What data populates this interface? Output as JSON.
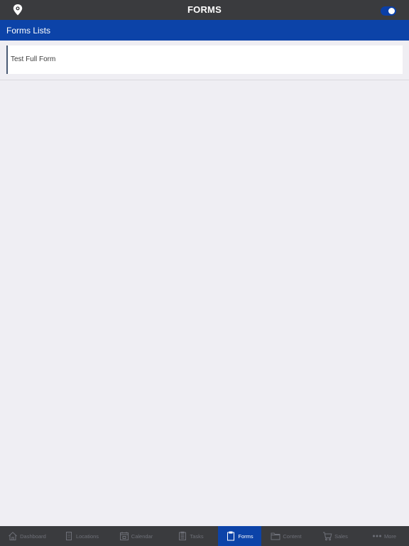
{
  "header": {
    "title": "FORMS",
    "location_icon": "map-pin-icon",
    "toggle_state": "on"
  },
  "section": {
    "title": "Forms Lists"
  },
  "forms": [
    {
      "name": "Test Full Form"
    }
  ],
  "tabbar": {
    "active": "Forms",
    "tabs": [
      {
        "label": "Dashboard",
        "icon": "home-icon"
      },
      {
        "label": "Locations",
        "icon": "building-icon"
      },
      {
        "label": "Calendar",
        "icon": "calendar-icon"
      },
      {
        "label": "Tasks",
        "icon": "tasks-icon"
      },
      {
        "label": "Forms",
        "icon": "clipboard-icon"
      },
      {
        "label": "Content",
        "icon": "folder-icon"
      },
      {
        "label": "Sales",
        "icon": "cart-icon"
      },
      {
        "label": "More",
        "icon": "more-dots-icon"
      }
    ]
  },
  "colors": {
    "topbar": "#3a3b3e",
    "accent_blue": "#0c43a8",
    "background": "#efeef3",
    "inactive_tab": "#6e7078"
  }
}
